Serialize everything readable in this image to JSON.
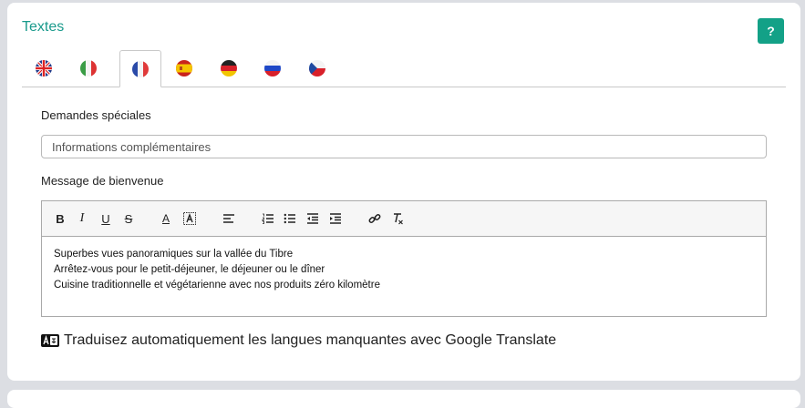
{
  "section": {
    "title": "Textes",
    "help_label": "?"
  },
  "tabs": [
    {
      "lang": "en",
      "icon": "uk-flag-icon"
    },
    {
      "lang": "it",
      "icon": "italy-flag-icon"
    },
    {
      "lang": "fr",
      "icon": "france-flag-icon",
      "active": true
    },
    {
      "lang": "es",
      "icon": "spain-flag-icon"
    },
    {
      "lang": "de",
      "icon": "germany-flag-icon"
    },
    {
      "lang": "ru",
      "icon": "russia-flag-icon"
    },
    {
      "lang": "cz",
      "icon": "czech-flag-icon"
    }
  ],
  "special_requests": {
    "label": "Demandes spéciales",
    "placeholder": "Informations complémentaires",
    "value": ""
  },
  "welcome": {
    "label": "Message de bienvenue",
    "lines": [
      "Superbes vues panoramiques sur la vallée du Tibre",
      "Arrêtez-vous pour le petit-déjeuner, le déjeuner ou le dîner",
      "Cuisine traditionnelle et végétarienne avec nos produits zéro kilomètre"
    ]
  },
  "toolbar": {
    "bold": "B",
    "italic": "I",
    "underline": "U",
    "strike": "S",
    "text_color": "A"
  },
  "translate": {
    "label": "Traduisez automatiquement les langues manquantes avec Google Translate"
  },
  "colors": {
    "accent": "#13a187",
    "title": "#1a9a8c",
    "background": "#dcdee3"
  }
}
